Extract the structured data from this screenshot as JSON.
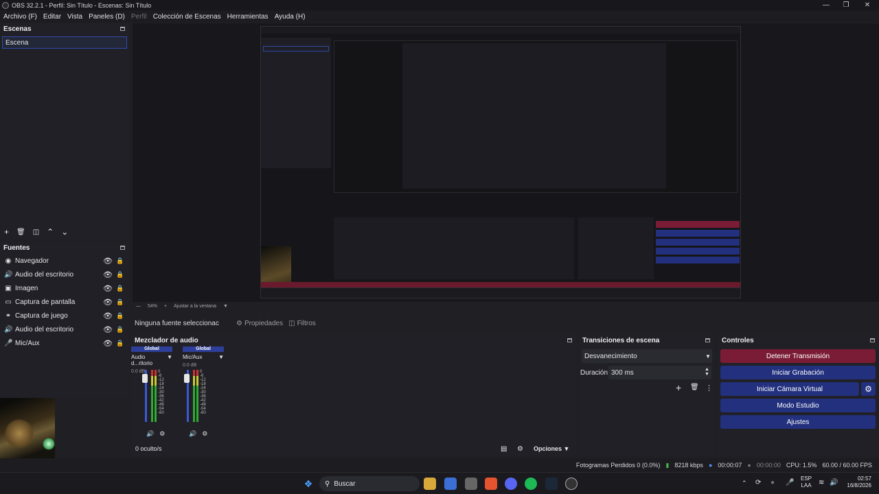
{
  "window": {
    "title": "OBS 32.2.1 - Perfil: Sin Título - Escenas: Sin Título"
  },
  "menu": [
    "Archivo (F)",
    "Editar",
    "Vista",
    "Paneles (D)",
    "Perfil",
    "Colección de Escenas",
    "Herramientas",
    "Ayuda (H)"
  ],
  "scenes": {
    "title": "Escenas",
    "items": [
      "Escena"
    ]
  },
  "sources": {
    "title": "Fuentes",
    "items": [
      "Navegador",
      "Audio del escritorio",
      "Imagen",
      "Captura de pantalla",
      "Captura de juego",
      "Audio del escritorio",
      "Mic/Aux"
    ]
  },
  "zoom": {
    "value": "54%",
    "fit": "Ajustar a la ventana"
  },
  "properties_bar": {
    "no_source": "Ninguna fuente seleccionac",
    "properties": "Propiedades",
    "filters": "Filtros"
  },
  "mixer": {
    "title": "Mezclador de audio",
    "channels": [
      {
        "header": "Global",
        "name": "Audio d...ritorio",
        "db": "0.0 dB"
      },
      {
        "header": "Global",
        "name": "Mic/Aux",
        "db": "0.0 dB"
      }
    ],
    "scale": [
      "0",
      "-6",
      "-12",
      "-18",
      "-24",
      "-30",
      "-36",
      "-42",
      "-48",
      "-54",
      "-60"
    ],
    "hidden": "0 oculto/s",
    "options": "Opciones"
  },
  "transitions": {
    "title": "Transiciones de escena",
    "type": "Desvanecimiento",
    "duration_label": "Duración",
    "duration": "300 ms"
  },
  "controls": {
    "title": "Controles",
    "stop_stream": "Detener Transmisión",
    "start_record": "Iniciar Grabación",
    "virtual_cam": "Iniciar Cámara Virtual",
    "studio": "Modo Estudio",
    "settings": "Ajustes"
  },
  "status": {
    "dropped": "Fotogramas Perdidos 0 (0.0%)",
    "bitrate": "8218 kbps",
    "stream_time": "00:00:07",
    "record_time": "00:00:00",
    "cpu": "CPU: 1.5%",
    "fps": "60.00 / 60.00 FPS"
  },
  "taskbar": {
    "search": "Buscar",
    "lang": "ESP",
    "lang2": "LAA",
    "time": "02:57",
    "date": "16/8/2026"
  },
  "colors": {
    "accent": "#2d3f98",
    "stream_btn": "#7a1c35",
    "blue_btn": "#22307e"
  }
}
